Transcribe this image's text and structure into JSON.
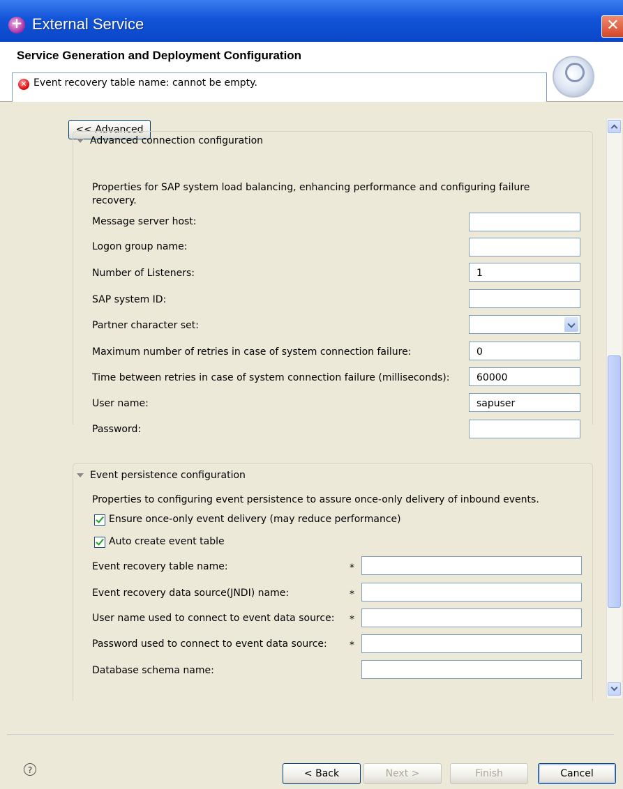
{
  "window": {
    "title": "External Service"
  },
  "header": {
    "page_title": "Service Generation and Deployment Configuration",
    "error_message": "Event recovery table name: cannot be empty."
  },
  "advanced_button": "<< Advanced",
  "advanced_connection": {
    "heading": "Advanced connection configuration",
    "description": "Properties for SAP system load balancing, enhancing performance and configuring failure recovery.",
    "fields": [
      {
        "label": "Message server host:",
        "value": ""
      },
      {
        "label": "Logon group name:",
        "value": ""
      },
      {
        "label": "Number of Listeners:",
        "value": "1"
      },
      {
        "label": "SAP system ID:",
        "value": ""
      },
      {
        "label": "Partner character set:",
        "value": ""
      },
      {
        "label": "Maximum number of retries in case of system connection failure:",
        "value": "0"
      },
      {
        "label": "Time between retries in case of system connection failure (milliseconds):",
        "value": "60000"
      },
      {
        "label": "User name:",
        "value": "sapuser"
      },
      {
        "label": "Password:",
        "value": ""
      }
    ]
  },
  "event_persistence": {
    "heading": "Event persistence configuration",
    "description": "Properties to configuring event persistence to assure once-only delivery of inbound events.",
    "checkboxes": [
      {
        "label": "Ensure once-only event delivery (may reduce performance)",
        "checked": true
      },
      {
        "label": "Auto create event table",
        "checked": true
      }
    ],
    "required_marker": "*",
    "fields": [
      {
        "label": "Event recovery table name:",
        "value": ""
      },
      {
        "label": "Event recovery data source(JNDI) name:",
        "value": ""
      },
      {
        "label": "User name used to connect to event data source:",
        "value": ""
      },
      {
        "label": "Password used to connect to event data source:",
        "value": ""
      },
      {
        "label": "Database schema name:",
        "value": ""
      }
    ]
  },
  "footer": {
    "help_label": "?",
    "back_label": "< Back",
    "next_label": "Next >",
    "finish_label": "Finish",
    "cancel_label": "Cancel"
  }
}
